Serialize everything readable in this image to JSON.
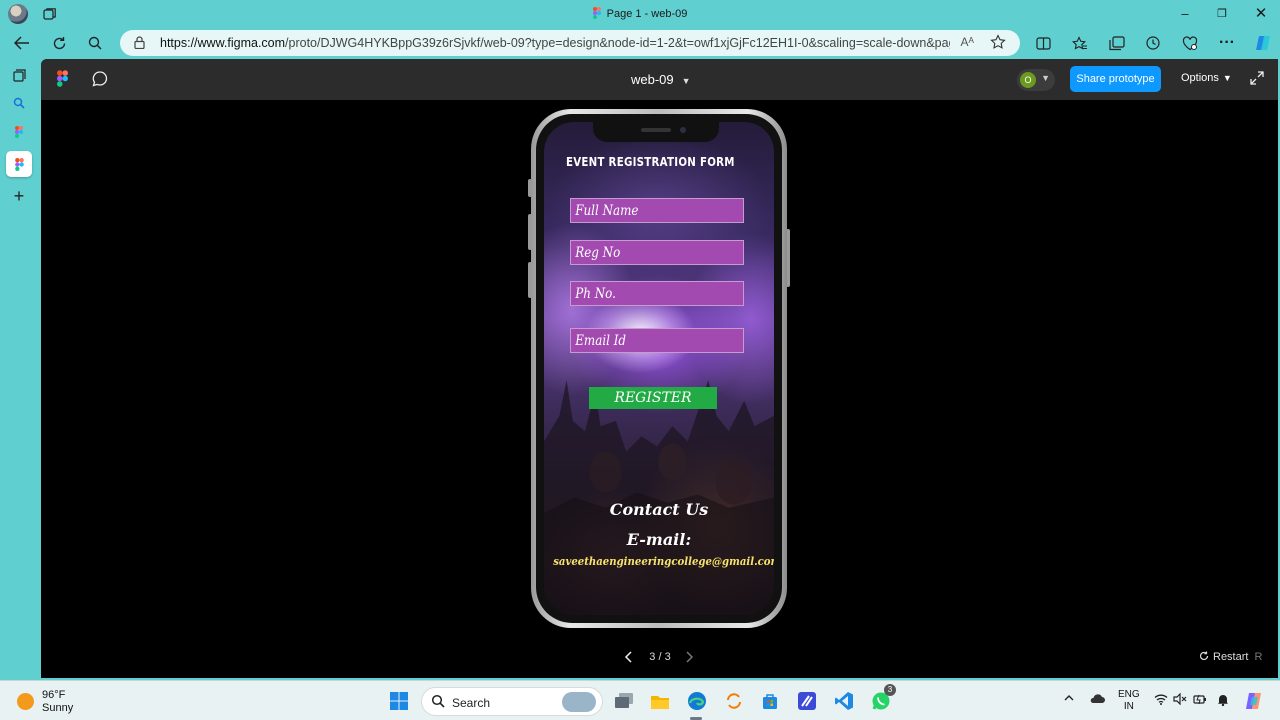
{
  "browser": {
    "tab_title": "Page 1 - web-09",
    "url_host": "https://www.figma.com",
    "url_rest": "/proto/DJWG4HYKBppG39z6rSjvkf/web-09?type=design&node-id=1-2&t=owf1xjGjFc12EH1I-0&scaling=scale-down&page-id=...",
    "read_aloud": "Aᴬ"
  },
  "figma": {
    "file_name": "web-09",
    "user_initial": "O",
    "share_label": "Share prototype",
    "options_label": "Options",
    "pager": "3 / 3",
    "restart_label": "Restart",
    "restart_key": "R"
  },
  "form": {
    "title": "EVENT  REGISTRATION FORM",
    "fields": [
      {
        "placeholder": "Full Name"
      },
      {
        "placeholder": "Reg No"
      },
      {
        "placeholder": "Ph No."
      },
      {
        "placeholder": "Email Id"
      }
    ],
    "register_label": "REGISTER",
    "contact_heading": "Contact Us",
    "email_heading": "E-mail:",
    "email_value": "saveethaengineeringcollege@gmail.com"
  },
  "taskbar": {
    "temperature": "96°F",
    "condition": "Sunny",
    "search_label": "Search",
    "whatsapp_badge": "3",
    "lang_line1": "ENG",
    "lang_line2": "IN"
  },
  "colors": {
    "accent": "#0d99ff",
    "field": "#a24ab0",
    "register": "#22aa44",
    "email_text": "#f7e36a"
  }
}
